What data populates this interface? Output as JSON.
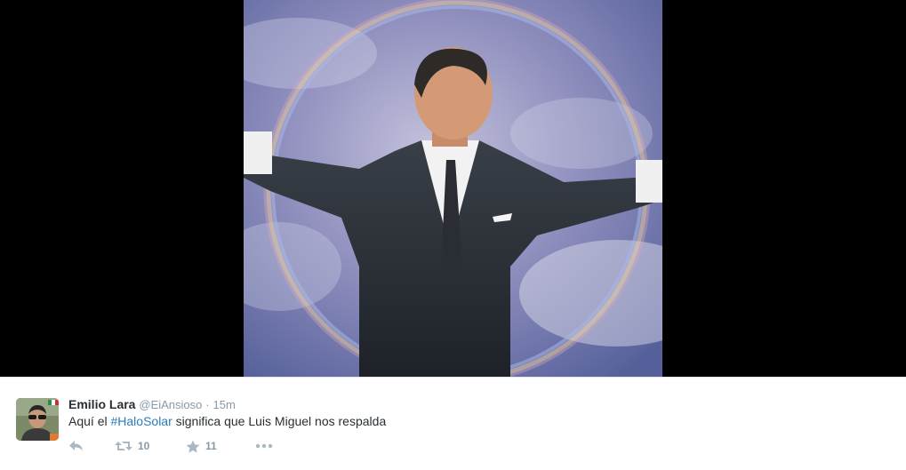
{
  "media": {
    "description_icon": "photo-halo-performer"
  },
  "tweet": {
    "fullname": "Emilio Lara",
    "username": "@EiAnsioso",
    "separator": "·",
    "time": "15m",
    "text_before": "Aquí el ",
    "hashtag": "#HaloSolar",
    "text_after": " significa que Luis Miguel nos respalda",
    "actions": {
      "reply_icon": "reply-icon",
      "retweet_icon": "retweet-icon",
      "retweet_count": "10",
      "favorite_icon": "star-icon",
      "favorite_count": "11",
      "more_icon": "more-icon"
    }
  },
  "colors": {
    "link": "#2b7bb9",
    "text": "#292f33",
    "muted": "#8899a6",
    "icon": "#aab8c2"
  }
}
